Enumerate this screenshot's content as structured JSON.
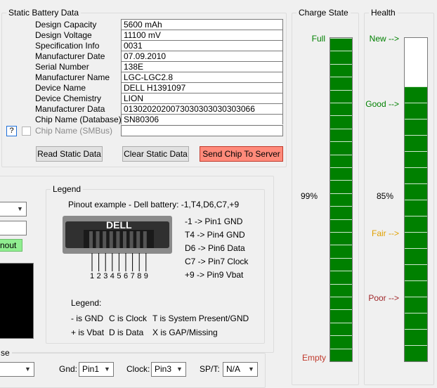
{
  "static_battery": {
    "title": "Static Battery Data",
    "rows": [
      {
        "label": "Design Capacity",
        "value": "5600 mAh"
      },
      {
        "label": "Design Voltage",
        "value": "11100 mV"
      },
      {
        "label": "Specification Info",
        "value": "0031"
      },
      {
        "label": "Manufacturer Date",
        "value": "07.09.2010"
      },
      {
        "label": "Serial Number",
        "value": "138E"
      },
      {
        "label": "Manufacturer Name",
        "value": "LGC-LGC2.8"
      },
      {
        "label": "Device Name",
        "value": "DELL H1391097"
      },
      {
        "label": "Device Chemistry",
        "value": "LION"
      },
      {
        "label": "Manufacturer Data",
        "value": "0130202020073030303030303066"
      },
      {
        "label": "Chip Name (Database)",
        "value": "SN80306"
      }
    ],
    "chip_smbus_label": "Chip Name (SMBus)",
    "chip_smbus_value": "",
    "help_label": "?",
    "read_button": "Read Static Data",
    "clear_button": "Clear Static Data",
    "send_button": "Send Chip To Server"
  },
  "charge_state": {
    "title": "Charge State",
    "full_label": "Full",
    "empty_label": "Empty",
    "percent_text": "99%",
    "level_percent": 99,
    "segment_count": 25
  },
  "health": {
    "title": "Health",
    "new_label": "New -->",
    "good_label": "Good -->",
    "fair_label": "Fair -->",
    "poor_label": "Poor -->",
    "percent_text": "85%",
    "level_percent": 85,
    "segment_count": 20
  },
  "legend": {
    "title": "Legend",
    "pinout_example": "Pinout example - Dell battery:   -1,T4,D6,C7,+9",
    "connector_brand": "DELL",
    "pin_numbers": [
      "1",
      "2",
      "3",
      "4",
      "5",
      "6",
      "7",
      "8",
      "9"
    ],
    "pin_map": [
      "-1 -> Pin1 GND",
      "T4 -> Pin4 GND",
      "D6 -> Pin6 Data",
      "C7 -> Pin7 Clock",
      "+9 -> Pin9 Vbat"
    ],
    "legend_heading": "Legend:",
    "legend_row1": [
      "- is GND",
      "C is Clock",
      "T is System Present/GND"
    ],
    "legend_row2": [
      "+ is Vbat",
      "D is Data",
      "X is GAP/Missing"
    ]
  },
  "left_panel": {
    "pinout_button": "nout",
    "bottom_group_title": "se"
  },
  "bottom": {
    "gnd_label": "Gnd:",
    "gnd_value": "Pin1",
    "clock_label": "Clock:",
    "clock_value": "Pin3",
    "spt_label": "SP/T:",
    "spt_value": "N/A"
  },
  "colors": {
    "bar_green": "#008000",
    "full_label": "#008000",
    "empty_label": "#c0392b",
    "new_label": "#008000",
    "good_label": "#008000",
    "fair_label": "#e0a000",
    "poor_label": "#a0282b",
    "send_button": "#ff8a7a"
  }
}
